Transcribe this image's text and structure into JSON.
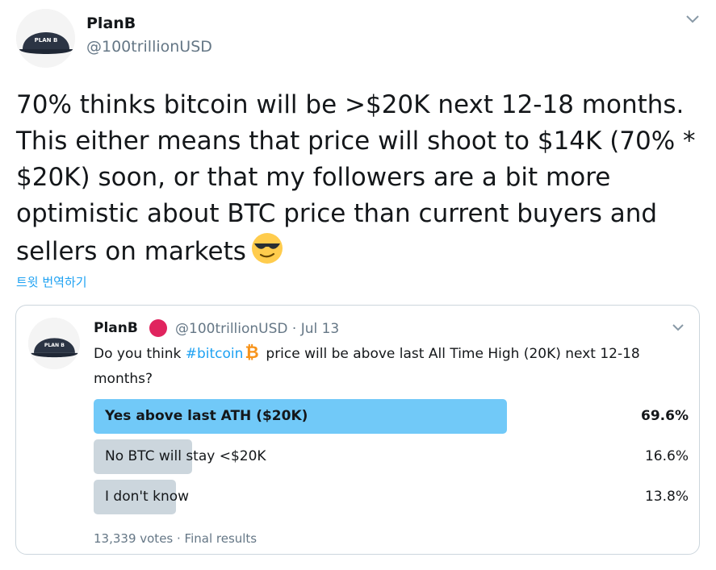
{
  "tweet": {
    "author_name": "PlanB",
    "author_handle": "@100trillionUSD",
    "avatar_logo": "PLAN B",
    "text": "70% thinks bitcoin will be >$20K next 12-18 months. This either means that price will shoot to $14K (70% * $20K) soon, or that my followers are a bit more optimistic about BTC price than current buyers and sellers on markets",
    "emoji": "smiling-face-with-sunglasses",
    "translate_label": "트윗 번역하기"
  },
  "quote": {
    "author_name": "PlanB",
    "author_handle_date": "@100trillionUSD · Jul 13",
    "text_prefix": "Do you think ",
    "hashtag": "#bitcoin",
    "text_suffix": "price will be above last All Time High (20K) next 12-18 months?",
    "poll": {
      "options": [
        {
          "label": "Yes above last ATH ($20K)",
          "percent_text": "69.6%",
          "percent": 69.6,
          "winner": true
        },
        {
          "label": "No BTC will stay <$20K",
          "percent_text": "16.6%",
          "percent": 16.6,
          "winner": false
        },
        {
          "label": "I don't know",
          "percent_text": "13.8%",
          "percent": 13.8,
          "winner": false
        }
      ],
      "meta": "13,339 votes · Final results"
    }
  },
  "colors": {
    "link": "#1da1f2",
    "winner_bar": "#71c9f8",
    "loser_bar": "#ccd6dd",
    "secondary_text": "#657786",
    "verified_dot": "#e0245e",
    "bitcoin": "#f7931a"
  },
  "icons": [
    "cap-logo-avatar",
    "chevron-down-icon",
    "bitcoin-icon",
    "sunglasses-emoji"
  ]
}
